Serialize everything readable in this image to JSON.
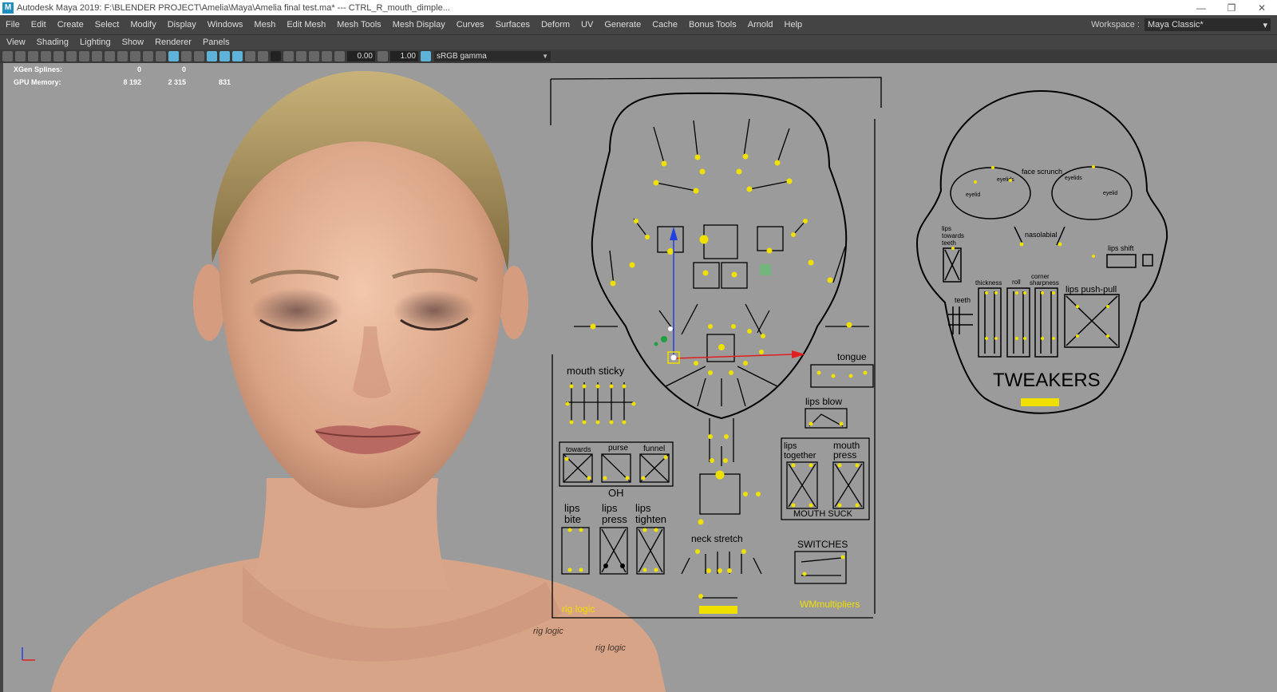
{
  "window": {
    "title": "Autodesk Maya 2019: F:\\BLENDER PROJECT\\Amelia\\Maya\\Amelia final test.ma*   ---   CTRL_R_mouth_dimple...",
    "app_icon": "M"
  },
  "menubar": {
    "items": [
      "File",
      "Edit",
      "Create",
      "Select",
      "Modify",
      "Display",
      "Windows",
      "Mesh",
      "Edit Mesh",
      "Mesh Tools",
      "Mesh Display",
      "Curves",
      "Surfaces",
      "Deform",
      "UV",
      "Generate",
      "Cache",
      "Bonus Tools",
      "Arnold",
      "Help"
    ],
    "workspace_label": "Workspace :",
    "workspace_value": "Maya Classic*"
  },
  "panel_menu": {
    "items": [
      "View",
      "Shading",
      "Lighting",
      "Show",
      "Renderer",
      "Panels"
    ]
  },
  "toolbar": {
    "field_a": "0.00",
    "field_b": "1.00",
    "color_space": "sRGB gamma"
  },
  "hud": {
    "rows": [
      {
        "label": "XGen Splines:",
        "v1": "0",
        "v2": "0",
        "v3": ""
      },
      {
        "label": "GPU Memory:",
        "v1": "8 192",
        "v2": "2 315",
        "v3": "831"
      }
    ]
  },
  "rig": {
    "mouth_sticky": "mouth sticky",
    "towards": "towards",
    "purse": "purse",
    "funnel": "funnel",
    "oh": "OH",
    "lips_bite_1": "lips",
    "lips_bite_2": "bite",
    "lips_press_1": "lips",
    "lips_press_2": "press",
    "lips_tighten_1": "lips",
    "lips_tighten_2": "tighten",
    "rig_logic": "rig logic",
    "neck_stretch": "neck stretch",
    "tongue": "tongue",
    "lips_blow": "lips blow",
    "lips_together_1": "lips",
    "lips_together_2": "together",
    "mouth_press_1": "mouth",
    "mouth_press_2": "press",
    "mouth_suck": "MOUTH SUCK",
    "switches": "SWITCHES",
    "wm_multipliers": "WMmultipliers"
  },
  "tweakers": {
    "face_scrunch": "face scrunch",
    "eyelids_l": "eyelids",
    "eyelids_r": "eyelids",
    "eyelid_l": "eyelid",
    "eyelid_r": "eyelid",
    "nasolabial": "nasolabial",
    "lips_towards_1": "lips",
    "lips_towards_2": "towards",
    "lips_towards_3": "teeth",
    "lips_shift": "lips shift",
    "thickness": "thickness",
    "roll": "roll",
    "corner_1": "corner",
    "corner_2": "sharpness",
    "lips_push_pull": "lips push-pull",
    "teeth": "teeth",
    "title": "TWEAKERS"
  },
  "viewport_text": {
    "rig_logic_mesh_1": "rig logic",
    "rig_logic_mesh_2": "rig logic"
  },
  "colors": {
    "viewport_bg": "#9b9b9b",
    "controller_yellow": "#f0e000",
    "axis_x": "#e02020",
    "axis_y": "#2040e0",
    "axis_z": "#20a040"
  }
}
